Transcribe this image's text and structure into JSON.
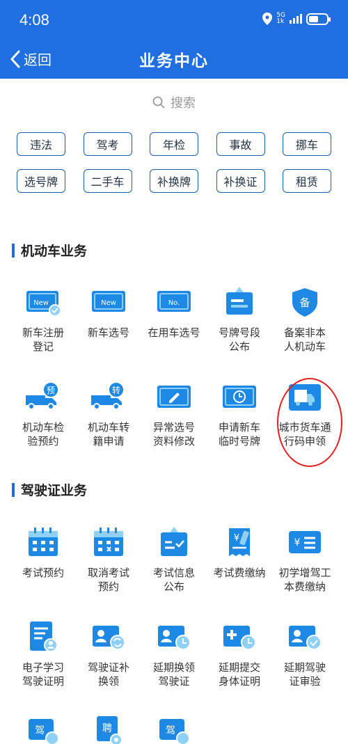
{
  "status": {
    "time": "4:08",
    "network": "5G",
    "network_sub": "1k"
  },
  "nav": {
    "back_label": "返回",
    "title": "业务中心"
  },
  "search": {
    "placeholder": "搜索"
  },
  "tags": [
    [
      "违法",
      "驾考",
      "年检",
      "事故",
      "挪车"
    ],
    [
      "选号牌",
      "二手车",
      "补换牌",
      "补换证",
      "租赁"
    ]
  ],
  "vehicle_section": {
    "title": "机动车业务",
    "items": [
      {
        "label": "新车注册\n登记",
        "icon": "new-plate-check-icon",
        "badge": "New"
      },
      {
        "label": "新车选号",
        "icon": "new-plate-icon",
        "badge": "New"
      },
      {
        "label": "在用车选号",
        "icon": "no-plate-icon",
        "badge": "No."
      },
      {
        "label": "号牌号段\n公布",
        "icon": "plate-announcement-icon"
      },
      {
        "label": "备案非本\n人机动车",
        "icon": "shield-record-icon",
        "badge": "备"
      },
      {
        "label": "机动车检\n验预约",
        "icon": "truck-appointment-icon",
        "badge": "预"
      },
      {
        "label": "机动车转\n籍申请",
        "icon": "truck-transfer-icon",
        "badge": "转"
      },
      {
        "label": "异常选号\n资料修改",
        "icon": "edit-plate-icon"
      },
      {
        "label": "申请新车\n临时号牌",
        "icon": "temp-plate-icon"
      },
      {
        "label": "城市货车通\n行码申领",
        "icon": "cargo-truck-icon"
      }
    ]
  },
  "license_section": {
    "title": "驾驶证业务",
    "items": [
      {
        "label": "考试预约",
        "icon": "calendar-icon"
      },
      {
        "label": "取消考试\n预约",
        "icon": "calendar-cancel-icon"
      },
      {
        "label": "考试信息\n公布",
        "icon": "exam-info-icon"
      },
      {
        "label": "考试费缴纳",
        "icon": "yuan-receipt-icon",
        "badge": "¥"
      },
      {
        "label": "初学增驾工\n本费缴纳",
        "icon": "yuan-card-icon",
        "badge": "¥"
      },
      {
        "label": "电子学习\n驾驶证明",
        "icon": "e-document-icon"
      },
      {
        "label": "驾驶证补\n换领",
        "icon": "license-renew-icon"
      },
      {
        "label": "延期换领\n驾驶证",
        "icon": "license-delay-icon"
      },
      {
        "label": "延期提交\n身体证明",
        "icon": "medical-delay-icon"
      },
      {
        "label": "延期驾驶\n证审验",
        "icon": "license-verify-icon"
      },
      {
        "label": "",
        "icon": "license-phone-icon",
        "badge": "驾"
      },
      {
        "label": "",
        "icon": "hire-settings-icon",
        "badge": "聘"
      },
      {
        "label": "",
        "icon": "license-e-icon",
        "badge": "驾"
      }
    ]
  },
  "colors": {
    "primary": "#1f6fe0",
    "icon_blue": "#1e88e5",
    "icon_light": "#8fd0f5",
    "annotation": "#e02020"
  }
}
